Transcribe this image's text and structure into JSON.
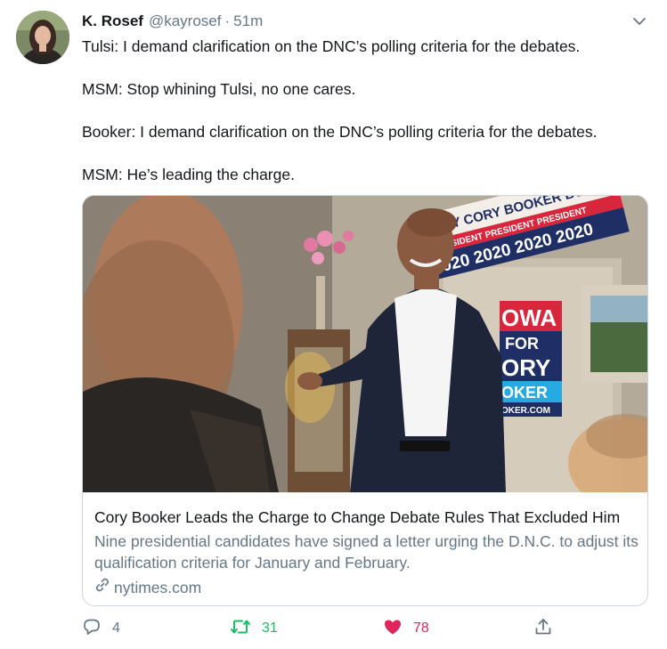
{
  "tweet": {
    "author_name": "K. Rosef",
    "handle": "@kayrosef",
    "separator": "·",
    "time": "51m",
    "paragraphs": [
      "Tulsi: I demand clarification on the DNC’s polling criteria for the debates.",
      "MSM: Stop whining Tulsi, no one cares.",
      "Booker: I demand clarification on the DNC’s polling criteria for the debates.",
      "MSM: He’s leading the charge."
    ]
  },
  "card": {
    "title": "Cory Booker Leads the Charge to Change Debate Rules That Excluded Him",
    "description": "Nine presidential candidates have signed a letter urging the D.N.C. to adjust its qualification criteria for January and February.",
    "domain": "nytimes.com",
    "banner_text": {
      "top": "CORY CORY BOOKER BOOKER",
      "middle": "PRESIDENT PRESIDENT PRESIDENT",
      "years": "2020 2020 2020 2020",
      "poster_lines": [
        "OWA",
        "FOR",
        "ORY",
        "OKER",
        "OKER.COM"
      ]
    }
  },
  "actions": {
    "reply_count": "4",
    "retweet_count": "31",
    "like_count": "78"
  },
  "colors": {
    "primary_text": "#14171a",
    "secondary_text": "#657786",
    "border": "#ccd6dd",
    "retweet_green": "#17bf63",
    "like_red": "#e0245e"
  },
  "icons": [
    "chevron-down-icon",
    "link-icon",
    "reply-icon",
    "retweet-icon",
    "heart-icon",
    "share-icon"
  ]
}
